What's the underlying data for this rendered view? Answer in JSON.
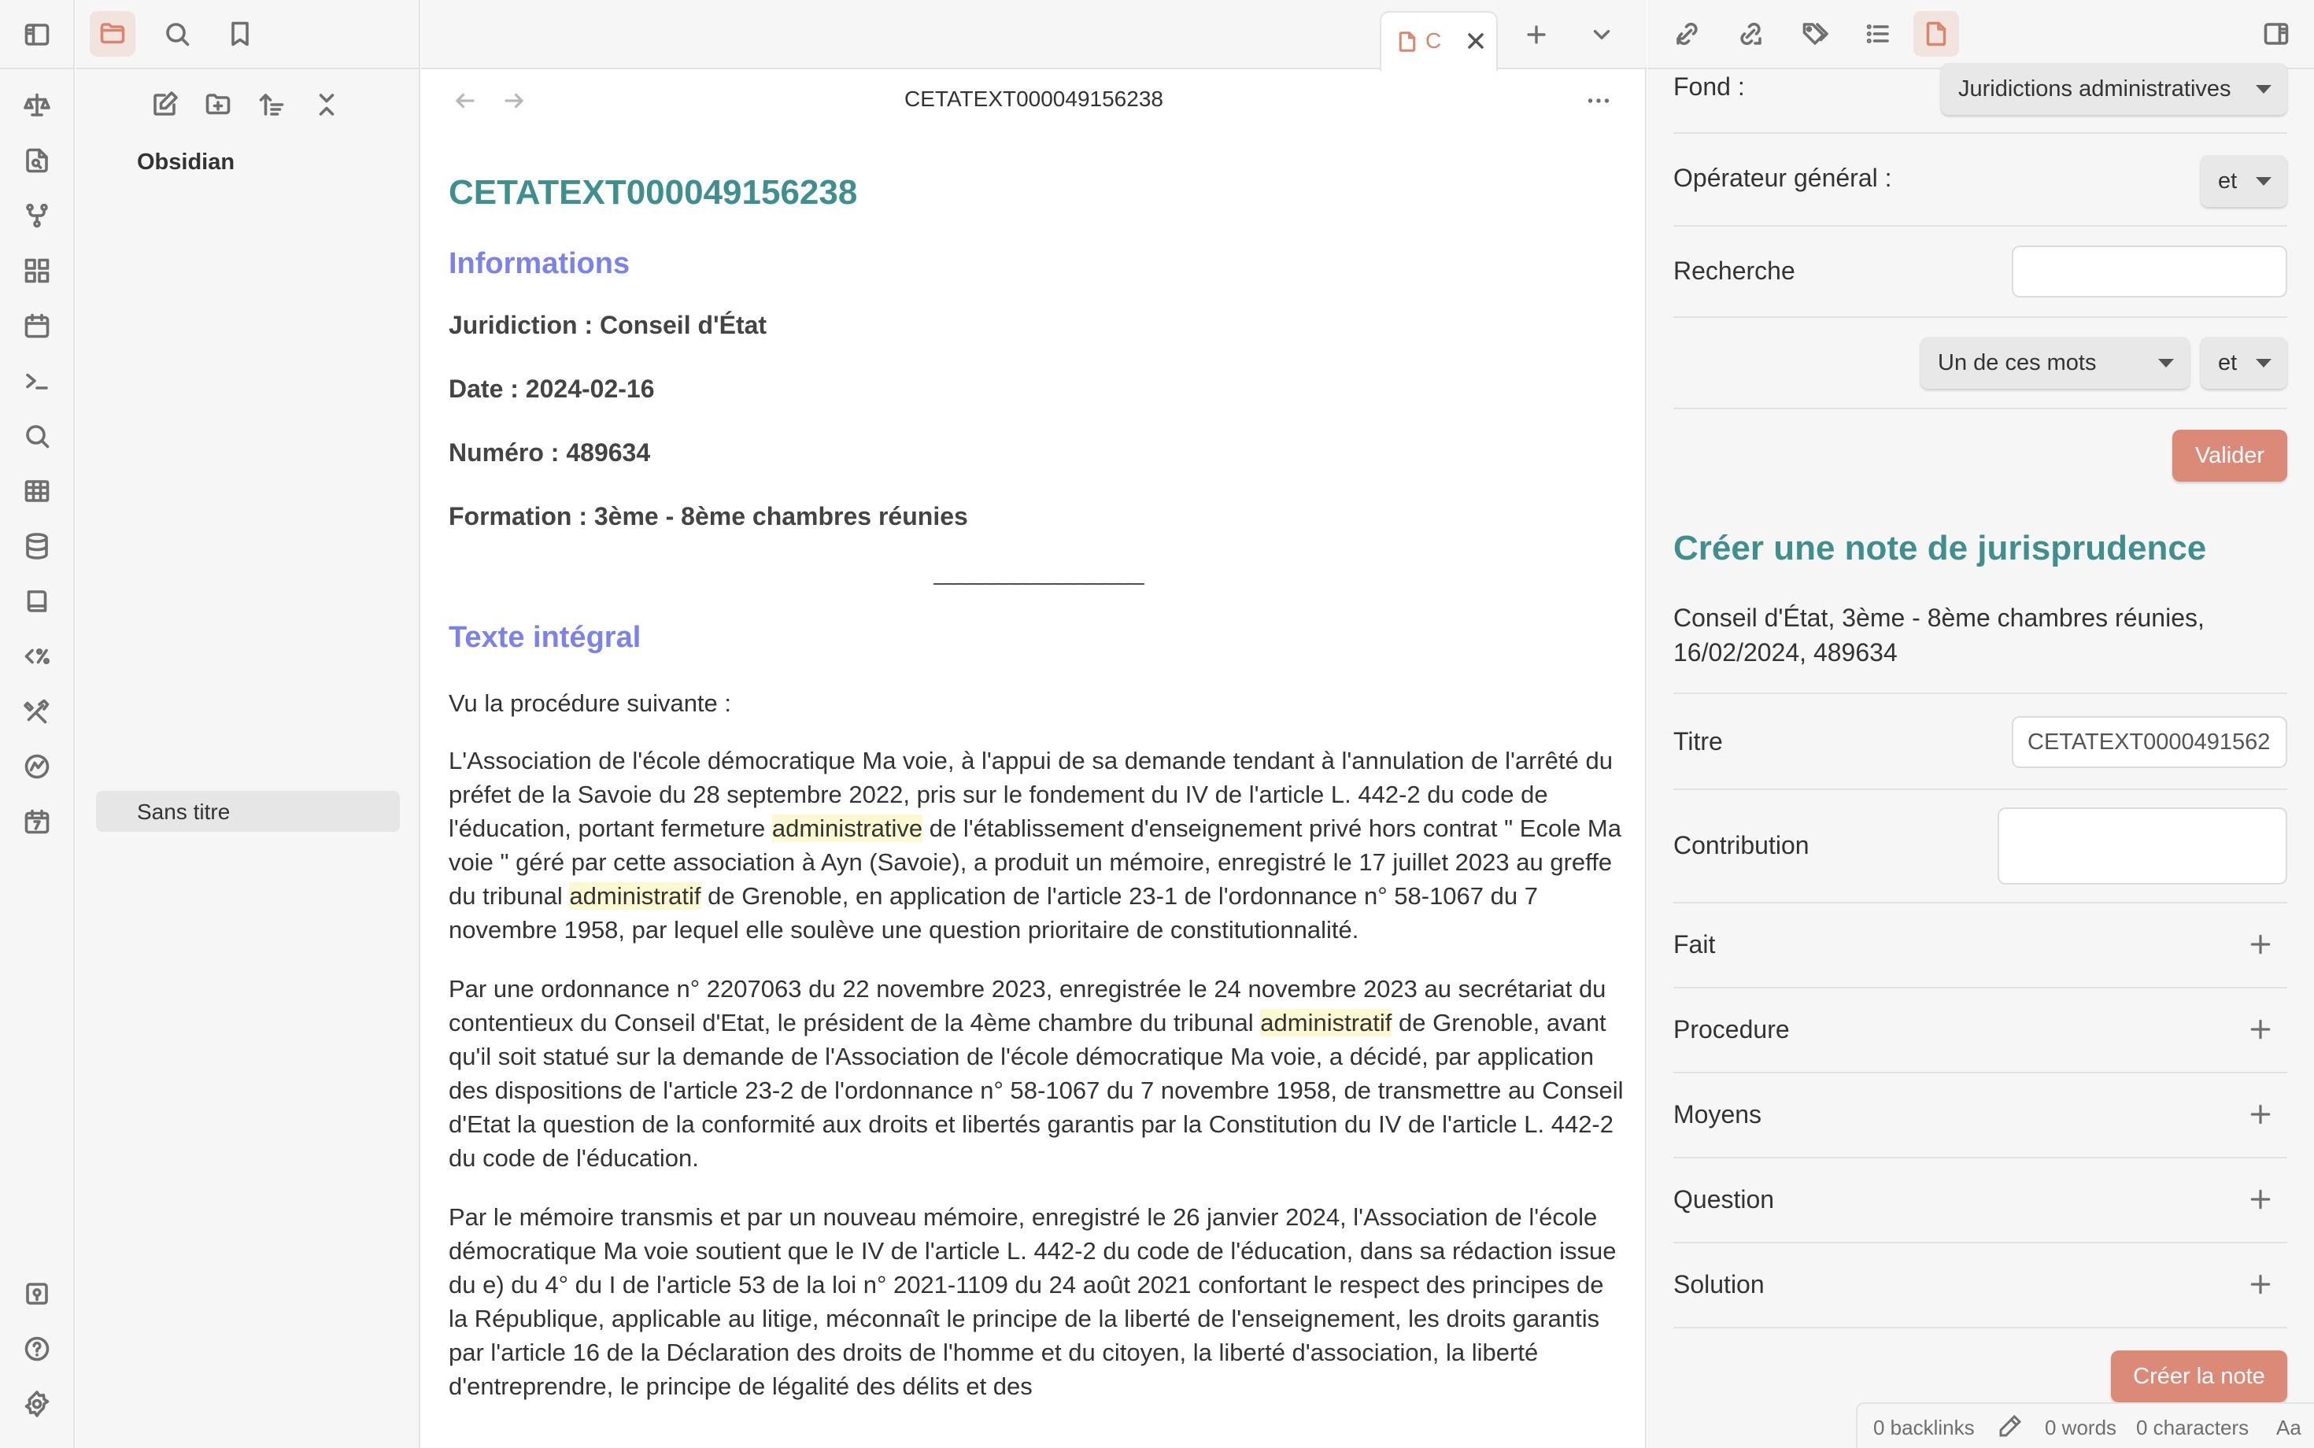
{
  "explorer": {
    "vault_name": "Obsidian",
    "files": [
      {
        "label": "Sans titre"
      }
    ]
  },
  "tab": {
    "title": "C"
  },
  "view_header": {
    "title": "CETATEXT000049156238"
  },
  "document": {
    "title": "CETATEXT000049156238",
    "info_heading": "Informations",
    "meta": [
      "Juridiction : Conseil d'État",
      "Date : 2024-02-16",
      "Numéro : 489634",
      "Formation : 3ème - 8ème chambres réunies"
    ],
    "separator": "________________",
    "text_heading": "Texte intégral",
    "intro": "Vu la procédure suivante :",
    "p1_a": "L'Association de l'école démocratique Ma voie, à l'appui de sa demande tendant à l'annulation de l'arrêté du préfet de la Savoie du 28 septembre 2022, pris sur le fondement du IV de l'article L. 442-2 du code de l'éducation, portant fermeture ",
    "p1_hl1": "administrative",
    "p1_b": " de l'établissement d'enseignement privé hors contrat \" Ecole Ma voie \" géré par cette association à Ayn (Savoie), a produit un mémoire, enregistré le 17 juillet 2023 au greffe du tribunal ",
    "p1_hl2": "administratif",
    "p1_c": " de Grenoble, en application de l'article 23-1 de l'ordonnance n° 58-1067 du 7 novembre 1958, par lequel elle soulève une question prioritaire de constitutionnalité.",
    "p2_a": "Par une ordonnance n° 2207063 du 22 novembre 2023, enregistrée le 24 novembre 2023 au secrétariat du contentieux du Conseil d'Etat, le président de la 4ème chambre du tribunal ",
    "p2_hl1": "administratif",
    "p2_b": " de Grenoble, avant qu'il soit statué sur la demande de l'Association de l'école démocratique Ma voie, a décidé, par application des dispositions de l'article 23-2 de l'ordonnance n° 58-1067 du 7 novembre 1958, de transmettre au Conseil d'Etat la question de la conformité aux droits et libertés garantis par la Constitution du IV de l'article L. 442-2 du code de l'éducation.",
    "p3": "Par le mémoire transmis et par un nouveau mémoire, enregistré le 26 janvier 2024, l'Association de l'école démocratique Ma voie soutient que le IV de l'article L. 442-2 du code de l'éducation, dans sa rédaction issue du e) du 4° du I de l'article 53 de la loi n° 2021-1109 du 24 août 2021 confortant le respect des principes de la République, applicable au litige, méconnaît le principe de la liberté de l'enseignement, les droits garantis par l'article 16 de la Déclaration des droits de l'homme et du citoyen, la liberté d'association, la liberté d'entreprendre, le principe de légalité des délits et des"
  },
  "search_form": {
    "fond_label": "Fond :",
    "fond_value": "Juridictions administratives",
    "operator_label": "Opérateur général :",
    "operator_value": "et",
    "search_label": "Recherche",
    "search_value": "",
    "match_mode_value": "Un de ces mots",
    "match_operator_value": "et",
    "submit_label": "Valider"
  },
  "note_form": {
    "heading": "Créer une note de jurisprudence",
    "citation": "Conseil d'État, 3ème - 8ème chambres réunies, 16/02/2024, 489634",
    "title_label": "Titre",
    "title_value": "CETATEXT0000491562",
    "contribution_label": "Contribution",
    "sections": [
      "Fait",
      "Procedure",
      "Moyens",
      "Question",
      "Solution"
    ],
    "create_label": "Créer la note"
  },
  "status_bar": {
    "backlinks": "0 backlinks",
    "words": "0 words",
    "characters": "0 characters",
    "font_toggle": "Aa"
  },
  "colors": {
    "accent": "#d9866e",
    "heading_teal": "#3f8f8f",
    "heading_blue": "#7b83eb",
    "highlight": "#fcf8d2",
    "button": "#dc8a78"
  }
}
